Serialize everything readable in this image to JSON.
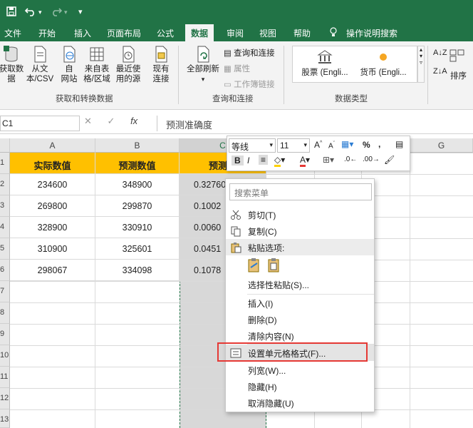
{
  "quick_access": {
    "save_icon": "save-icon",
    "undo_icon": "undo-icon",
    "redo_icon": "redo-icon",
    "customize": "▾"
  },
  "tabs": [
    "文件",
    "开始",
    "插入",
    "页面布局",
    "公式",
    "数据",
    "审阅",
    "视图",
    "帮助",
    "操作说明搜索"
  ],
  "active_tab": "数据",
  "ribbon": {
    "get_data": "获取数\n据",
    "from_text": "从文\n本/CSV",
    "from_web": "自\n网站",
    "from_table": "来自表\n格/区域",
    "recent_sources": "最近使\n用的源",
    "existing_conn": "现有\n连接",
    "group1": "获取和转换数据",
    "refresh_all": "全部刷新",
    "queries_conn": "查询和连接",
    "properties": "属性",
    "edit_links": "工作簿链接",
    "group2": "查询和连接",
    "stock": "股票 (Engli...",
    "currency": "货币 (Engli...",
    "group3": "数据类型",
    "sort": "排序"
  },
  "formula_bar": {
    "name_box": "C1",
    "fx": "fx",
    "content": "预测准确度"
  },
  "columns": [
    "A",
    "B",
    "C",
    "D",
    "E",
    "F",
    "G"
  ],
  "rows": [
    "1",
    "2",
    "3",
    "4",
    "5",
    "6",
    "7",
    "8",
    "9",
    "10",
    "11",
    "12",
    "13"
  ],
  "table": {
    "headers": [
      "实际数值",
      "预测数值",
      "预测准"
    ],
    "data": [
      [
        "234600",
        "348900",
        "0.327601808"
      ],
      [
        "269800",
        "299870",
        "0.1002"
      ],
      [
        "328900",
        "330910",
        "0.0060"
      ],
      [
        "310900",
        "325601",
        "0.0451"
      ],
      [
        "298067",
        "334098",
        "0.1078"
      ]
    ]
  },
  "mini_toolbar": {
    "font": "等线",
    "size": "11",
    "bold": "B",
    "italic": "I",
    "percent": "%",
    "comma": ","
  },
  "context_menu": {
    "search": "搜索菜单",
    "cut": "剪切(T)",
    "copy": "复制(C)",
    "paste_options": "粘贴选项:",
    "paste_special": "选择性粘贴(S)...",
    "insert": "插入(I)",
    "delete": "删除(D)",
    "clear": "清除内容(N)",
    "format_cells": "设置单元格格式(F)...",
    "col_width": "列宽(W)...",
    "hide": "隐藏(H)",
    "unhide": "取消隐藏(U)"
  },
  "colors": {
    "excel_green": "#217346",
    "header_fill": "#ffc000",
    "highlight": "#e53935"
  }
}
